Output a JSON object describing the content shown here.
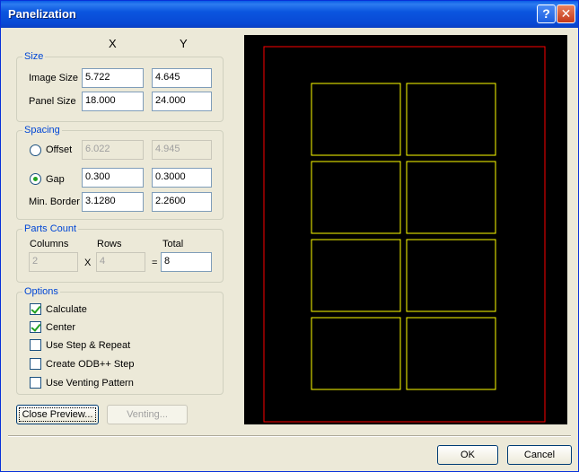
{
  "window": {
    "title": "Panelization"
  },
  "columns": {
    "x": "X",
    "y": "Y"
  },
  "size": {
    "legend": "Size",
    "image_size_label": "Image Size",
    "image_x": "5.722",
    "image_y": "4.645",
    "panel_size_label": "Panel Size",
    "panel_x": "18.000",
    "panel_y": "24.000"
  },
  "spacing": {
    "legend": "Spacing",
    "offset_label": "Offset",
    "offset_x": "6.022",
    "offset_y": "4.945",
    "gap_label": "Gap",
    "gap_x": "0.300",
    "gap_y": "0.3000",
    "min_border_label": "Min. Border",
    "min_border_x": "3.1280",
    "min_border_y": "2.2600"
  },
  "parts": {
    "legend": "Parts Count",
    "columns_label": "Columns",
    "rows_label": "Rows",
    "total_label": "Total",
    "columns": "2",
    "rows": "4",
    "total": "8",
    "times": "X",
    "equals": "="
  },
  "options": {
    "legend": "Options",
    "items": [
      {
        "label": "Calculate",
        "checked": true
      },
      {
        "label": "Center",
        "checked": true
      },
      {
        "label": "Use Step & Repeat",
        "checked": false
      },
      {
        "label": "Create ODB++ Step",
        "checked": false
      },
      {
        "label": "Use Venting Pattern",
        "checked": false
      }
    ]
  },
  "buttons": {
    "close_preview": "Close Preview...",
    "venting": "Venting...",
    "ok": "OK",
    "cancel": "Cancel"
  },
  "preview": {
    "panel_border_color": "#ff0000",
    "image_color": "#ffff00",
    "columns": 2,
    "rows": 4
  }
}
